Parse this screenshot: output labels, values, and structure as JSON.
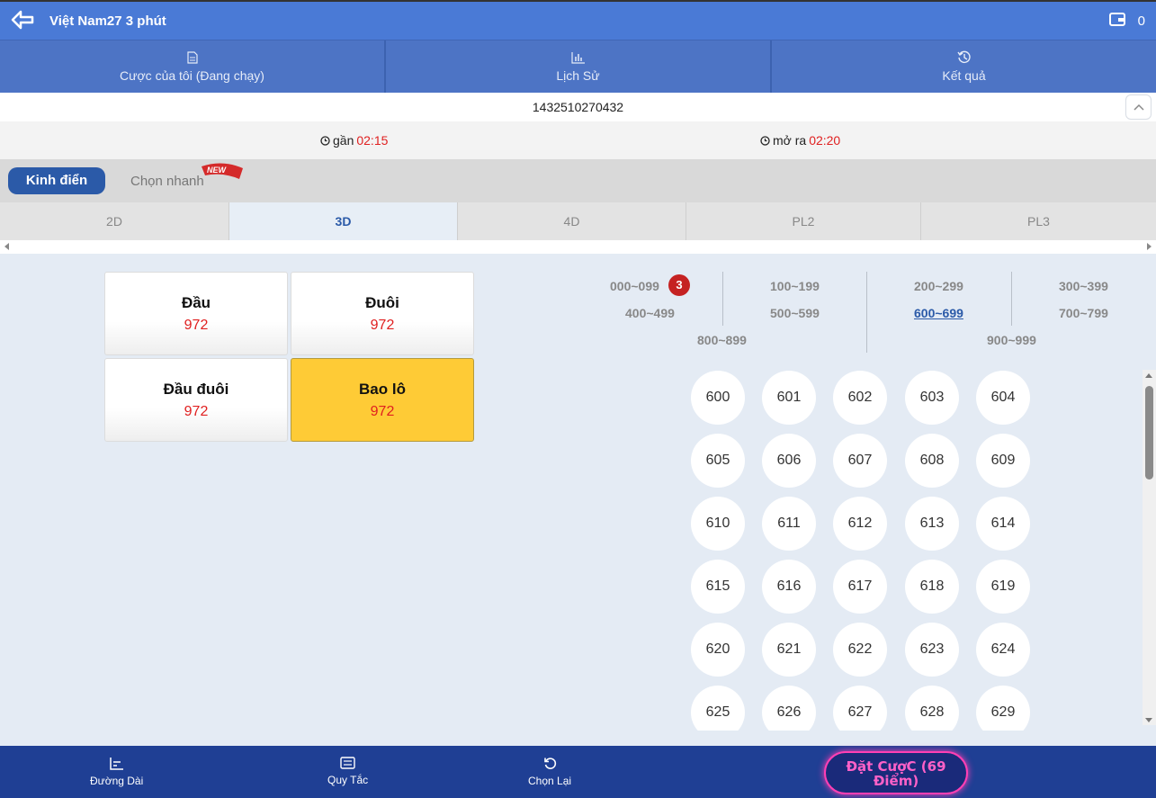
{
  "header": {
    "title": "Việt Nam27 3 phút",
    "balance": "0"
  },
  "topnav": [
    {
      "label": "Cược của tôi (Đang chạy)",
      "icon": "document-icon"
    },
    {
      "label": "Lịch Sử",
      "icon": "chart-icon"
    },
    {
      "label": "Kết quả",
      "icon": "history-icon"
    }
  ],
  "draw_id": "1432510270432",
  "timers": {
    "close_label": "gần",
    "close_time": "02:15",
    "open_label": "mở ra",
    "open_time": "02:20"
  },
  "modes": {
    "classic": "Kinh điển",
    "quick": "Chọn nhanh",
    "new_badge": "NEW"
  },
  "game_tabs": [
    "2D",
    "3D",
    "4D",
    "PL2",
    "PL3"
  ],
  "active_game_tab": "3D",
  "bet_types": [
    {
      "name": "Đầu",
      "odds": "972"
    },
    {
      "name": "Đuôi",
      "odds": "972"
    },
    {
      "name": "Đầu đuôi",
      "odds": "972"
    },
    {
      "name": "Bao lô",
      "odds": "972"
    }
  ],
  "selected_bet_type": "Bao lô",
  "ranges": [
    "000~099",
    "100~199",
    "200~299",
    "300~399",
    "400~499",
    "500~599",
    "600~699",
    "700~799",
    "800~899",
    "900~999"
  ],
  "active_range": "600~699",
  "range_badge": "3",
  "numbers": [
    "600",
    "601",
    "602",
    "603",
    "604",
    "605",
    "606",
    "607",
    "608",
    "609",
    "610",
    "611",
    "612",
    "613",
    "614",
    "615",
    "616",
    "617",
    "618",
    "619",
    "620",
    "621",
    "622",
    "623",
    "624",
    "625",
    "626",
    "627",
    "628",
    "629"
  ],
  "footer": {
    "trend": "Đường Dài",
    "rules": "Quy Tắc",
    "reset": "Chọn Lại",
    "bet_line1": "Đặt CượC (69",
    "bet_line2": "Điểm)"
  },
  "colors": {
    "header": "#4a7ad6",
    "nav": "#4d74c5",
    "accent": "#2b5aa8",
    "selected": "#fecb36",
    "odds": "#e02020",
    "footer": "#1f3f94",
    "bet_glow": "#ff3fb4"
  }
}
